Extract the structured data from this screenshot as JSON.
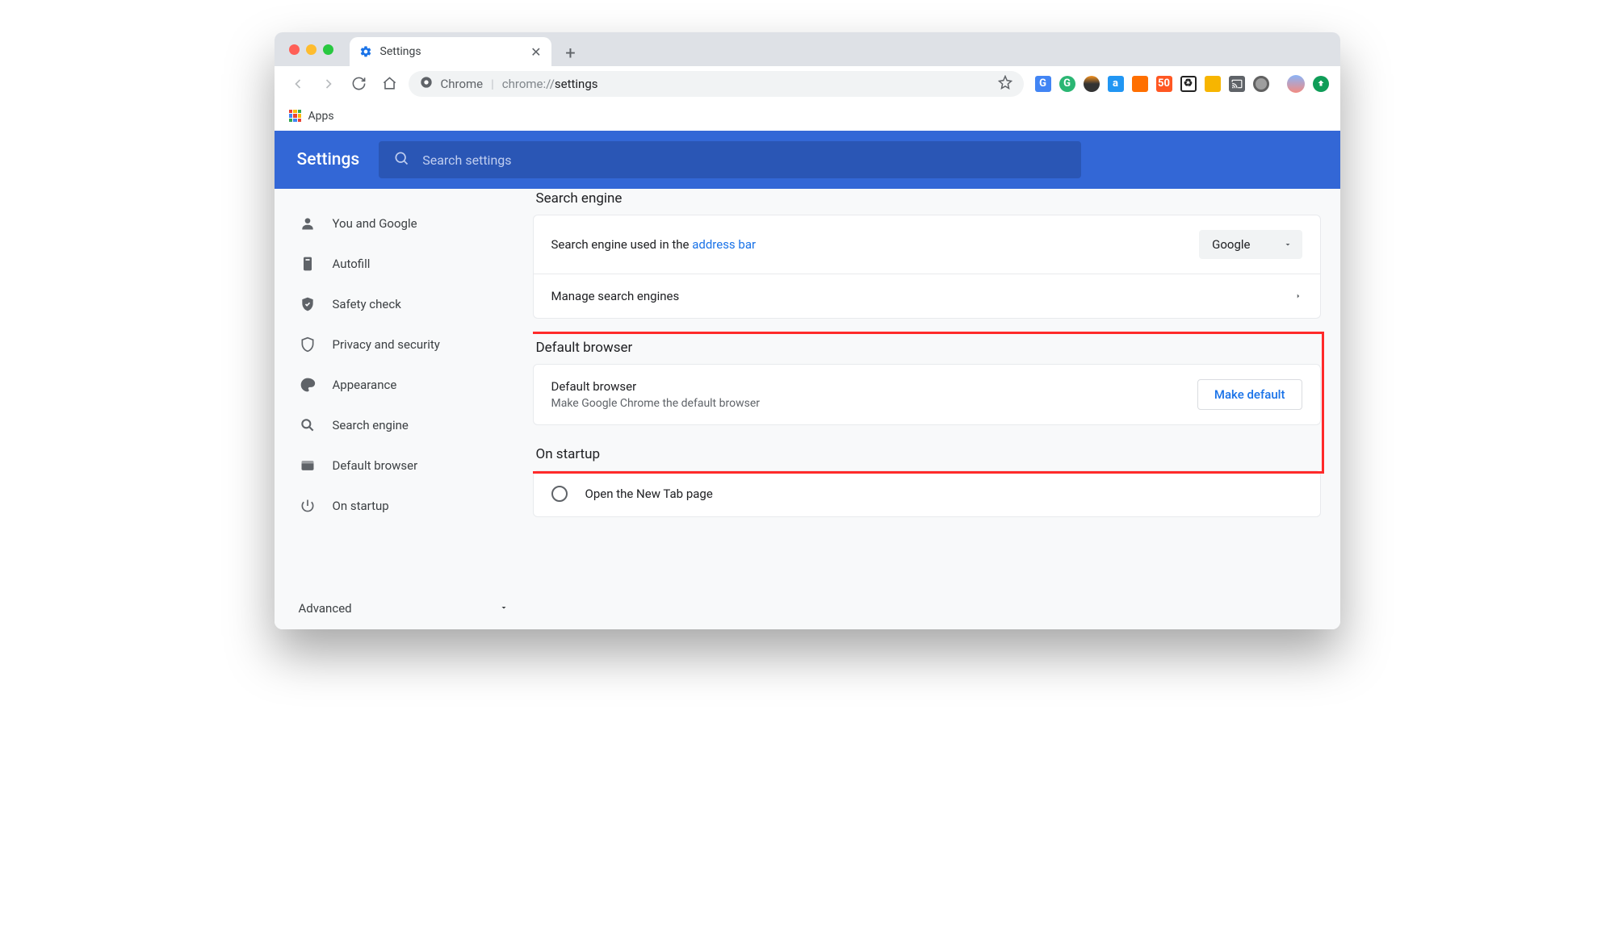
{
  "tab": {
    "title": "Settings"
  },
  "omnibox": {
    "lead": "Chrome",
    "path_prefix": "chrome://",
    "path_suffix": "settings"
  },
  "bookmarks": {
    "apps": "Apps"
  },
  "header": {
    "title": "Settings",
    "search_placeholder": "Search settings"
  },
  "sidebar": {
    "items": [
      {
        "label": "You and Google"
      },
      {
        "label": "Autofill"
      },
      {
        "label": "Safety check"
      },
      {
        "label": "Privacy and security"
      },
      {
        "label": "Appearance"
      },
      {
        "label": "Search engine"
      },
      {
        "label": "Default browser"
      },
      {
        "label": "On startup"
      }
    ],
    "advanced": "Advanced"
  },
  "sections": {
    "search_engine_title": "Search engine",
    "search_row_prefix": "Search engine used in the ",
    "search_row_link": "address bar",
    "search_select_value": "Google",
    "manage": "Manage search engines",
    "default_browser_title": "Default browser",
    "default_row_title": "Default browser",
    "default_row_sub": "Make Google Chrome the default browser",
    "make_default": "Make default",
    "startup_title": "On startup",
    "startup_opt1": "Open the New Tab page"
  }
}
